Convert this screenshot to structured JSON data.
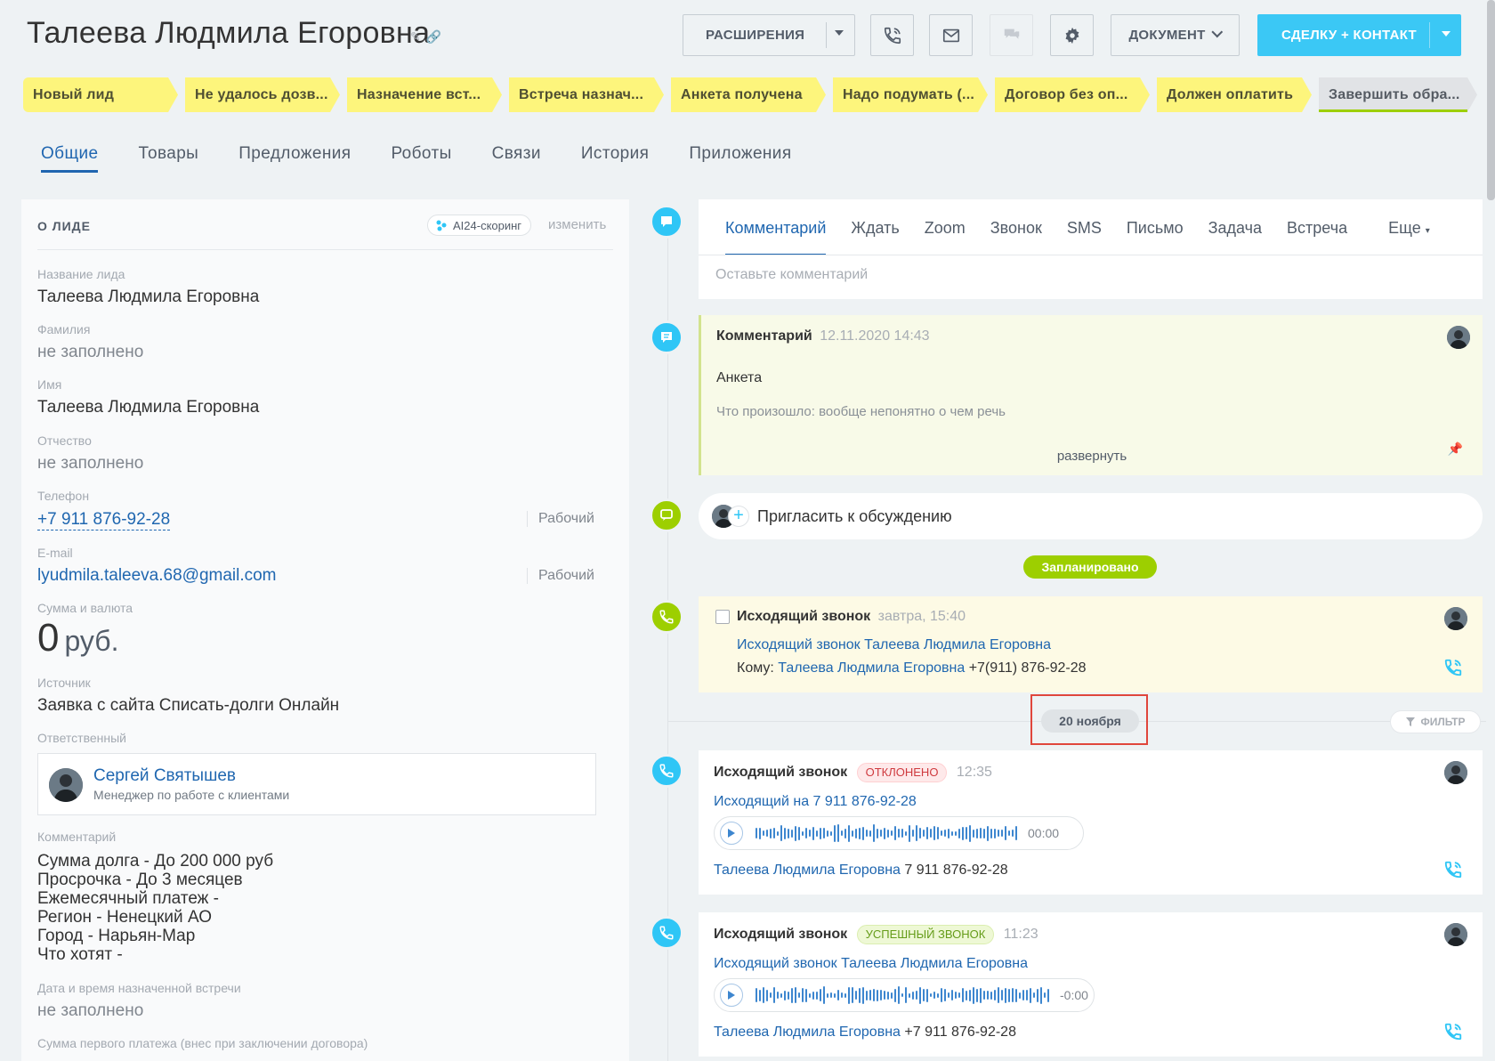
{
  "header": {
    "title": "Талеева Людмила  Егоровна",
    "buttons": {
      "extensions": "РАСШИРЕНИЯ",
      "document": "ДОКУМЕНТ",
      "deal_contact": "СДЕЛКУ + КОНТАКТ"
    }
  },
  "stages": [
    "Новый лид",
    "Не удалось дозв...",
    "Назначение вст...",
    "Встреча назнач...",
    "Анкета получена",
    "Надо подумать (...",
    "Договор без оп...",
    "Должен оплатить",
    "Завершить обра..."
  ],
  "tabs": [
    "Общие",
    "Товары",
    "Предложения",
    "Роботы",
    "Связи",
    "История",
    "Приложения"
  ],
  "lead": {
    "section_title": "О ЛИДЕ",
    "ai_scoring": "AI24-скоринг",
    "change": "изменить",
    "fields": {
      "name_label": "Название лида",
      "name": "Талеева Людмила Егоровна",
      "surname_label": "Фамилия",
      "surname": "не заполнено",
      "firstname_label": "Имя",
      "firstname": "Талеева Людмила Егоровна",
      "patronymic_label": "Отчество",
      "patronymic": "не заполнено",
      "phone_label": "Телефон",
      "phone": "+7 911 876-92-28",
      "phone_type": "Рабочий",
      "email_label": "E-mail",
      "email": "lyudmila.taleeva.68@gmail.com",
      "email_type": "Рабочий",
      "sum_label": "Сумма и валюта",
      "sum": "0",
      "currency": "руб.",
      "source_label": "Источник",
      "source": "Заявка с сайта Списать-долги Онлайн",
      "responsible_label": "Ответственный",
      "responsible_name": "Сергей Святышев",
      "responsible_position": "Менеджер по работе с клиентами",
      "comment_label": "Комментарий",
      "comment": "Сумма долга - До 200 000 руб\nПросрочка - До 3 месяцев\nЕжемесячный платеж -\nРегион - Ненецкий АО\nГород - Нарьян-Мар\nЧто хотят -",
      "meeting_label": "Дата и время назначенной встречи",
      "meeting": "не заполнено",
      "first_payment_label": "Сумма первого платежа (внес при заключении договора)"
    }
  },
  "composer": {
    "tabs": [
      "Комментарий",
      "Ждать",
      "Zoom",
      "Звонок",
      "SMS",
      "Письмо",
      "Задача",
      "Встреча",
      "Еще"
    ],
    "placeholder": "Оставьте комментарий"
  },
  "timeline": {
    "comment": {
      "title": "Комментарий",
      "date": "12.11.2020 14:43",
      "line1": "Анкета",
      "line2": "Что произошло: вообще непонятно о чем речь",
      "expand": "развернуть"
    },
    "invite": "Пригласить к обсуждению",
    "planned": "Запланировано",
    "planned_call": {
      "title": "Исходящий звонок",
      "time": "завтра, 15:40",
      "subject": "Исходящий звонок Талеева Людмила Егоровна",
      "to_label": "Кому:",
      "to_name": "Талеева Людмила Егоровна",
      "to_phone": "+7(911) 876-92-28"
    },
    "date_marker": "20 ноября",
    "filter": "ФИЛЬТР",
    "call1": {
      "title": "Исходящий звонок",
      "status": "ОТКЛОНЕНО",
      "time": "12:35",
      "subject": "Исходящий на 7 911 876-92-28",
      "duration": "00:00",
      "contact_name": "Талеева Людмила Егоровна",
      "contact_phone": "7 911 876-92-28"
    },
    "call2": {
      "title": "Исходящий звонок",
      "status": "УСПЕШНЫЙ ЗВОНОК",
      "time": "11:23",
      "subject": "Исходящий звонок Талеева Людмила Егоровна",
      "duration": "-0:00",
      "contact_name": "Талеева Людмила Егоровна",
      "contact_phone": "+7 911 876-92-28"
    }
  },
  "colors": {
    "accent_blue": "#2fc6f6",
    "link": "#2067b0",
    "stage_yellow": "#fdf57c",
    "timeline_green": "#9dcf00",
    "highlight_red": "#e0463c"
  }
}
